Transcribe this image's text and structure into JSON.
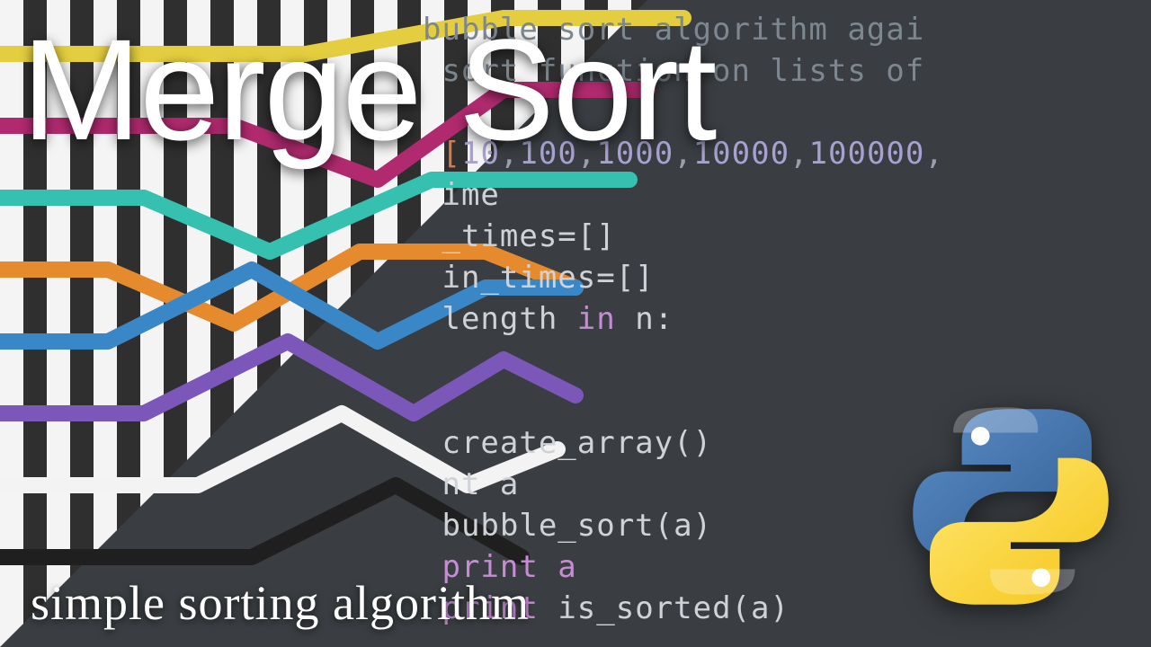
{
  "title": "Merge Sort",
  "subtitle": "simple sorting algorithm",
  "logo_name": "python-logo",
  "code": {
    "line1": "bubble sort algorithm agai",
    "line2": "sort function on lists of",
    "nums": [
      "10",
      "100",
      "1000",
      "10000",
      "100000"
    ],
    "line4": "ime",
    "line5": "_times=[]",
    "line6": "in_times=[]",
    "line7": "length",
    "in_kw": "in",
    "n_var": "n:",
    "line8": "create_array()",
    "line9": "nt a",
    "line10": "bubble_sort(a)",
    "line11": "print a",
    "line12_a": "print",
    "line12_b": "is_sorted(a)"
  },
  "line_colors": {
    "yellow": "#e4ce3f",
    "magenta": "#b12a6f",
    "teal": "#35c0b0",
    "orange": "#e68a2e",
    "blue": "#3a87c8",
    "purple": "#7a57b8",
    "white": "#f3f3f3",
    "black": "#1f1f1f"
  }
}
